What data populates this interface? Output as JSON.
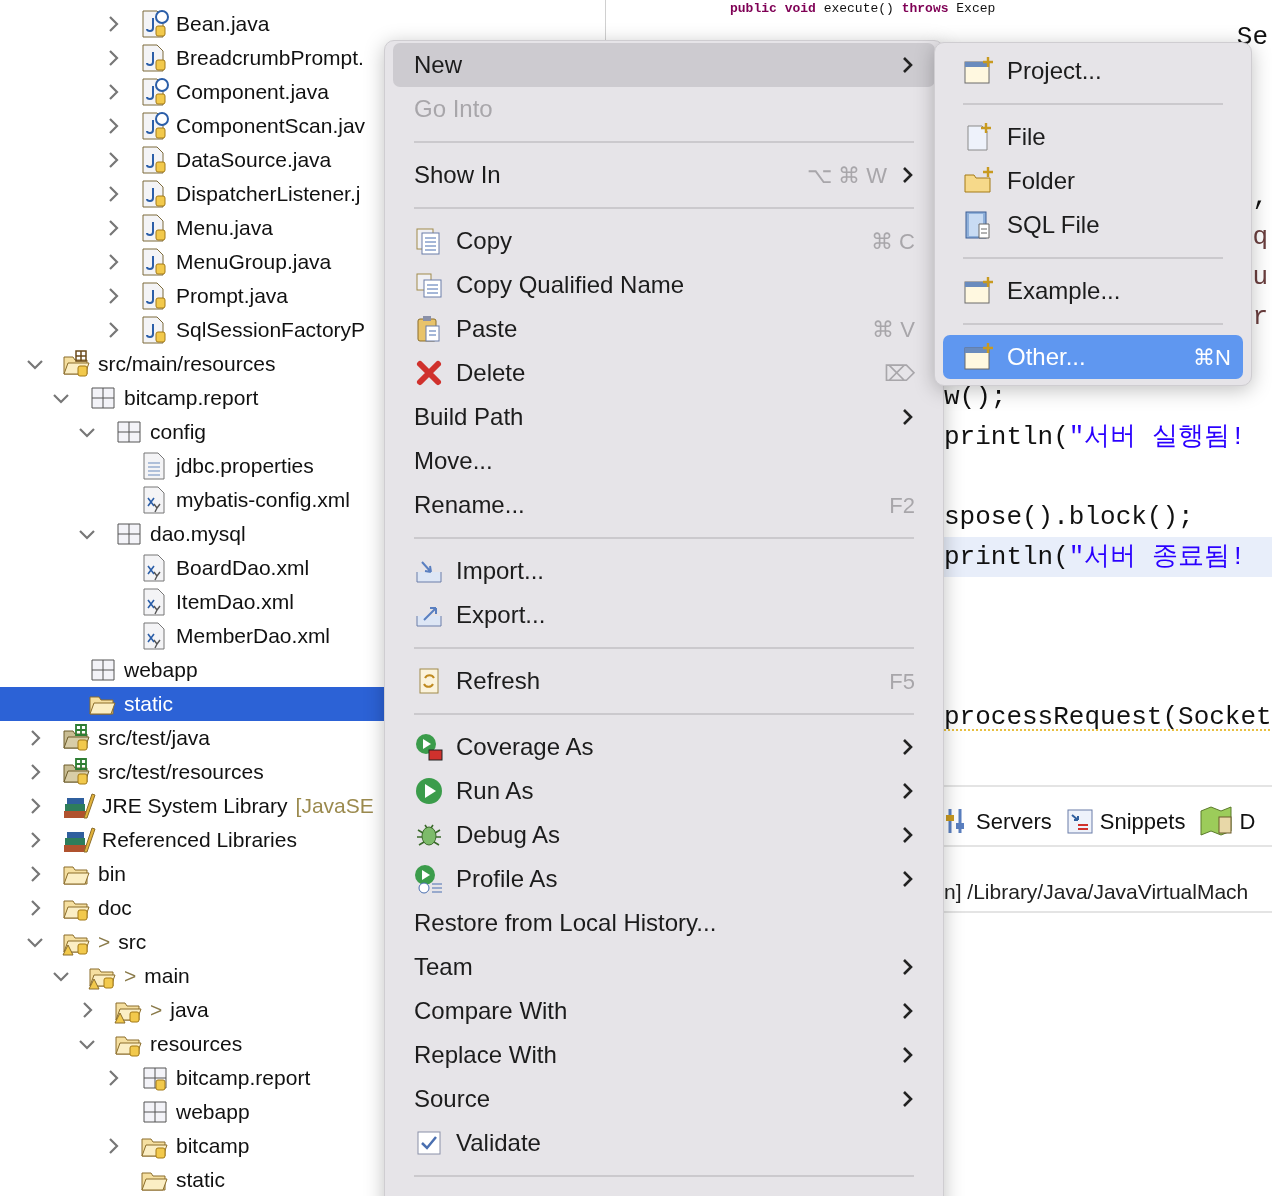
{
  "tree": {
    "continued_items": [
      {
        "label": "Bean.java",
        "kind": "java-annotation",
        "expanded": false
      },
      {
        "label": "BreadcrumbPrompt.",
        "kind": "java",
        "expanded": false
      },
      {
        "label": "Component.java",
        "kind": "java-annotation",
        "expanded": false
      },
      {
        "label": "ComponentScan.jav",
        "kind": "java-annotation",
        "expanded": false
      },
      {
        "label": "DataSource.java",
        "kind": "java",
        "expanded": false
      },
      {
        "label": "DispatcherListener.j",
        "kind": "java",
        "expanded": false
      },
      {
        "label": "Menu.java",
        "kind": "java",
        "expanded": false
      },
      {
        "label": "MenuGroup.java",
        "kind": "java",
        "expanded": false
      },
      {
        "label": "Prompt.java",
        "kind": "java",
        "expanded": false
      },
      {
        "label": "SqlSessionFactoryP",
        "kind": "java",
        "expanded": false
      }
    ],
    "items": [
      {
        "label": "src/main/resources",
        "kind": "source-folder",
        "expanded": true,
        "selected": false,
        "children": [
          {
            "label": "bitcamp.report",
            "kind": "package",
            "expanded": true,
            "selected": false,
            "children": [
              {
                "label": "config",
                "kind": "package",
                "expanded": true,
                "selected": false,
                "children": [
                  {
                    "label": "jdbc.properties",
                    "kind": "properties",
                    "selected": false
                  },
                  {
                    "label": "mybatis-config.xml",
                    "kind": "xml",
                    "selected": false
                  }
                ]
              },
              {
                "label": "dao.mysql",
                "kind": "package",
                "expanded": true,
                "selected": false,
                "children": [
                  {
                    "label": "BoardDao.xml",
                    "kind": "xml",
                    "selected": false
                  },
                  {
                    "label": "ItemDao.xml",
                    "kind": "xml",
                    "selected": false
                  },
                  {
                    "label": "MemberDao.xml",
                    "kind": "xml",
                    "selected": false
                  }
                ]
              }
            ]
          },
          {
            "label": "webapp",
            "kind": "package",
            "selected": false
          },
          {
            "label": "static",
            "kind": "folder",
            "selected": true
          }
        ]
      },
      {
        "label": "src/test/java",
        "kind": "test-folder",
        "expanded": false,
        "selected": false
      },
      {
        "label": "src/test/resources",
        "kind": "test-folder",
        "expanded": false,
        "selected": false
      },
      {
        "label": "JRE System Library",
        "decoration": "[JavaSE",
        "kind": "library",
        "expanded": false,
        "selected": false
      },
      {
        "label": "Referenced Libraries",
        "kind": "library",
        "expanded": false,
        "selected": false
      },
      {
        "label": "bin",
        "kind": "folder",
        "expanded": false,
        "selected": false
      },
      {
        "label": "doc",
        "kind": "folder-tracked",
        "expanded": false,
        "selected": false
      },
      {
        "prefix": ">",
        "label": "src",
        "kind": "folder-warning",
        "expanded": true,
        "selected": false,
        "children": [
          {
            "prefix": ">",
            "label": "main",
            "kind": "folder-warning",
            "expanded": true,
            "selected": false,
            "children": [
              {
                "prefix": ">",
                "label": "java",
                "kind": "folder-warning",
                "expanded": false,
                "selected": false
              },
              {
                "label": "resources",
                "kind": "folder-tracked",
                "expanded": true,
                "selected": false,
                "children": [
                  {
                    "label": "bitcamp.report",
                    "kind": "package-tracked",
                    "expanded": false,
                    "selected": false
                  },
                  {
                    "label": "webapp",
                    "kind": "package",
                    "selected": false
                  },
                  {
                    "label": "bitcamp",
                    "kind": "folder-tracked",
                    "expanded": false,
                    "selected": false
                  },
                  {
                    "label": "static",
                    "kind": "folder",
                    "selected": false
                  }
                ]
              }
            ]
          }
        ]
      }
    ]
  },
  "context_menu": {
    "items": [
      {
        "kind": "item",
        "label": "New",
        "submenu": true,
        "selected": true,
        "disabled": false
      },
      {
        "kind": "item",
        "label": "Go Into",
        "selected": false,
        "disabled": true
      },
      {
        "kind": "separator"
      },
      {
        "kind": "item",
        "label": "Show In",
        "shortcut": "⌥ ⌘ W",
        "submenu": true,
        "selected": false,
        "disabled": false
      },
      {
        "kind": "separator"
      },
      {
        "kind": "item",
        "label": "Copy",
        "shortcut": "⌘ C",
        "selected": false,
        "disabled": false
      },
      {
        "kind": "item",
        "label": "Copy Qualified Name",
        "selected": false,
        "disabled": false
      },
      {
        "kind": "item",
        "label": "Paste",
        "shortcut": "⌘ V",
        "selected": false,
        "disabled": false
      },
      {
        "kind": "item",
        "label": "Delete",
        "shortcut": "⌦",
        "selected": false,
        "disabled": false
      },
      {
        "kind": "item",
        "label": "Build Path",
        "submenu": true,
        "selected": false,
        "disabled": false
      },
      {
        "kind": "item",
        "label": "Move...",
        "selected": false,
        "disabled": false
      },
      {
        "kind": "item",
        "label": "Rename...",
        "shortcut": "F2",
        "selected": false,
        "disabled": false
      },
      {
        "kind": "separator"
      },
      {
        "kind": "item",
        "label": "Import...",
        "selected": false,
        "disabled": false
      },
      {
        "kind": "item",
        "label": "Export...",
        "selected": false,
        "disabled": false
      },
      {
        "kind": "separator"
      },
      {
        "kind": "item",
        "label": "Refresh",
        "shortcut": "F5",
        "selected": false,
        "disabled": false
      },
      {
        "kind": "separator"
      },
      {
        "kind": "item",
        "label": "Coverage As",
        "submenu": true,
        "selected": false,
        "disabled": false
      },
      {
        "kind": "item",
        "label": "Run As",
        "submenu": true,
        "selected": false,
        "disabled": false
      },
      {
        "kind": "item",
        "label": "Debug As",
        "submenu": true,
        "selected": false,
        "disabled": false
      },
      {
        "kind": "item",
        "label": "Profile As",
        "submenu": true,
        "selected": false,
        "disabled": false
      },
      {
        "kind": "item",
        "label": "Restore from Local History...",
        "selected": false,
        "disabled": false
      },
      {
        "kind": "item",
        "label": "Team",
        "submenu": true,
        "selected": false,
        "disabled": false
      },
      {
        "kind": "item",
        "label": "Compare With",
        "submenu": true,
        "selected": false,
        "disabled": false
      },
      {
        "kind": "item",
        "label": "Replace With",
        "submenu": true,
        "selected": false,
        "disabled": false
      },
      {
        "kind": "item",
        "label": "Source",
        "submenu": true,
        "selected": false,
        "disabled": false
      },
      {
        "kind": "item",
        "label": "Validate",
        "selected": false,
        "disabled": false
      },
      {
        "kind": "separator"
      }
    ]
  },
  "new_submenu": {
    "items": [
      {
        "kind": "item",
        "label": "Project...",
        "selected": false
      },
      {
        "kind": "separator"
      },
      {
        "kind": "item",
        "label": "File",
        "selected": false
      },
      {
        "kind": "item",
        "label": "Folder",
        "selected": false
      },
      {
        "kind": "item",
        "label": "SQL File",
        "selected": false
      },
      {
        "kind": "separator"
      },
      {
        "kind": "item",
        "label": "Example...",
        "selected": false
      },
      {
        "kind": "separator"
      },
      {
        "kind": "item",
        "label": "Other...",
        "shortcut": "⌘N",
        "selected": true
      }
    ]
  },
  "editor": {
    "top_line": [
      {
        "kind": "keyword",
        "text": "public"
      },
      {
        "kind": "keyword",
        "text": "void"
      },
      {
        "kind": "plain",
        "text": "execute()"
      },
      {
        "kind": "keyword",
        "text": "throws"
      },
      {
        "kind": "plain",
        "text": "Excep"
      }
    ],
    "lines": [
      {
        "kind": "fragment",
        "segments": [
          {
            "kind": "plain",
            "text": "Se"
          }
        ]
      },
      {
        "kind": "blank"
      },
      {
        "kind": "blank"
      },
      {
        "kind": "blank"
      },
      {
        "kind": "fragment",
        "segments": [
          {
            "kind": "plain",
            "text": ","
          }
        ]
      },
      {
        "kind": "fragment",
        "segments": [
          {
            "kind": "variable",
            "text": "q"
          }
        ]
      },
      {
        "kind": "fragment",
        "segments": [
          {
            "kind": "variable",
            "text": "u"
          }
        ]
      },
      {
        "kind": "fragment",
        "segments": [
          {
            "kind": "variable",
            "text": "r"
          }
        ]
      },
      {
        "kind": "blank"
      },
      {
        "kind": "tail",
        "segments": [
          {
            "kind": "plain",
            "text": "w();"
          }
        ]
      },
      {
        "kind": "tail",
        "segments": [
          {
            "kind": "plain",
            "text": "println("
          },
          {
            "kind": "string",
            "text": "\"서버 실행됨!"
          }
        ]
      },
      {
        "kind": "blank"
      },
      {
        "kind": "tail",
        "segments": [
          {
            "kind": "plain",
            "text": "spose().block();"
          }
        ]
      },
      {
        "kind": "tail",
        "current": true,
        "segments": [
          {
            "kind": "plain",
            "text": "println("
          },
          {
            "kind": "string",
            "text": "\"서버 종료됨!"
          }
        ]
      },
      {
        "kind": "blank"
      },
      {
        "kind": "blank"
      },
      {
        "kind": "blank"
      },
      {
        "kind": "tail",
        "warning": true,
        "segments": [
          {
            "kind": "plain",
            "text": "processRequest(Socket"
          }
        ]
      }
    ]
  },
  "bottom_panel": {
    "tabs": [
      {
        "label": "Servers"
      },
      {
        "label": "Snippets"
      },
      {
        "label": "D"
      }
    ],
    "console_line": "n] /Library/Java/JavaVirtualMach"
  }
}
